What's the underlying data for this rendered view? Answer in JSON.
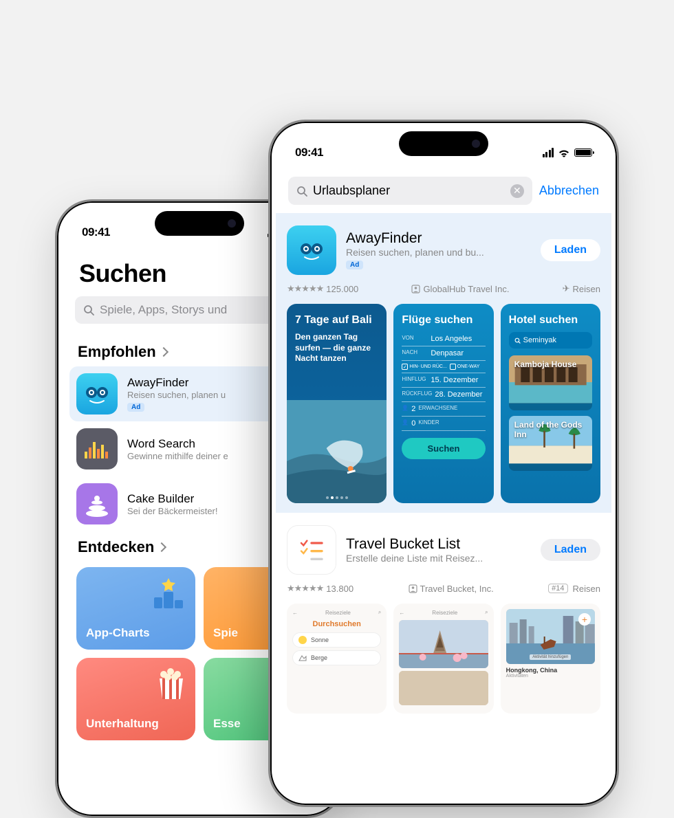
{
  "status": {
    "time": "09:41"
  },
  "back_phone": {
    "title": "Suchen",
    "placeholder": "Spiele, Apps, Storys und",
    "sections": {
      "recommended": "Empfohlen",
      "discover": "Entdecken"
    },
    "apps": {
      "awayfinder": {
        "name": "AwayFinder",
        "sub": "Reisen suchen, planen u",
        "ad": "Ad"
      },
      "wordsearch": {
        "name": "Word Search",
        "sub": "Gewinne mithilfe deiner e"
      },
      "cakebuilder": {
        "name": "Cake Builder",
        "sub": "Sei der Bäckermeister!"
      }
    },
    "tiles": {
      "charts": "App-Charts",
      "spiele": "Spie",
      "unterhaltung": "Unterhaltung",
      "essen": "Esse"
    }
  },
  "front_phone": {
    "search_value": "Urlaubsplaner",
    "cancel": "Abbrechen",
    "load": "Laden",
    "results": {
      "awayfinder": {
        "name": "AwayFinder",
        "sub": "Reisen suchen, planen und bu...",
        "ad": "Ad",
        "ratings": "125.000",
        "developer": "GlobalHub Travel Inc.",
        "category": "Reisen"
      },
      "bucketlist": {
        "name": "Travel Bucket List",
        "sub": "Erstelle deine Liste mit Reisez...",
        "ratings": "13.800",
        "developer": "Travel Bucket, Inc.",
        "rank": "#14",
        "category": "Reisen"
      }
    },
    "shots": {
      "s1": {
        "title": "7 Tage auf Bali",
        "sub": "Den ganzen Tag surfen — die ganze Nacht tanzen"
      },
      "s2": {
        "title": "Flüge suchen",
        "from_lbl": "VON",
        "from": "Los Angeles",
        "to_lbl": "NACH",
        "to": "Denpasar",
        "check1": "HIN- UND RÜC...",
        "check2": "ONE-WAY",
        "dep_lbl": "HINFLUG",
        "dep": "15. Dezember",
        "ret_lbl": "RÜCKFLUG",
        "ret": "28. Dezember",
        "adults_lbl": "ERWACHSENE",
        "adults": "2",
        "kids_lbl": "KINDER",
        "kids": "0",
        "btn": "Suchen"
      },
      "s3": {
        "title": "Hotel suchen",
        "search": "Seminyak",
        "hotel1": "Kamboja House",
        "hotel2": "Land of the Gods Inn"
      }
    },
    "small_shots": {
      "hdr": "Reiseziele",
      "browse": "Durchsuchen",
      "sun": "Sonne",
      "berge": "Berge",
      "loc": "Hongkong, China",
      "loc_sub": "Aktivitäten",
      "add": "Aktivität hinzufügen"
    }
  }
}
